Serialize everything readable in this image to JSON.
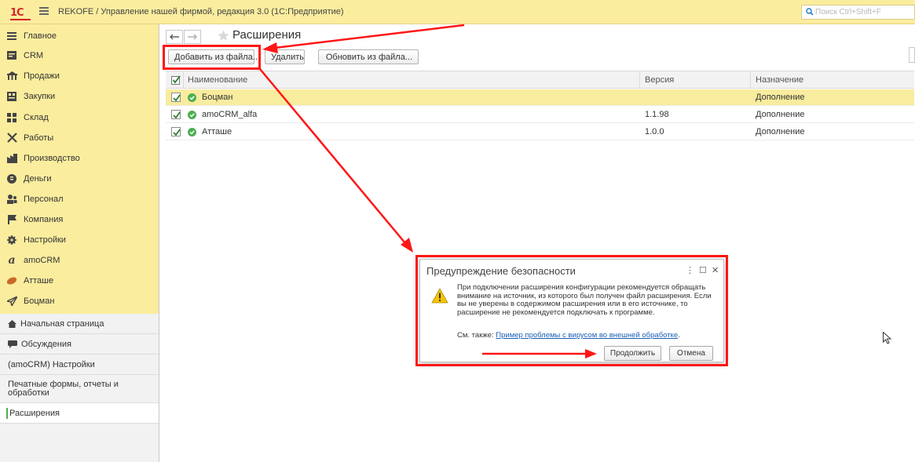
{
  "window": {
    "logo": "1С",
    "title": "REKOFE / Управление нашей фирмой, редакция 3.0  (1С:Предприятие)",
    "search_placeholder": "Поиск Ctrl+Shift+F"
  },
  "sidebar": {
    "sections": [
      {
        "label": "Главное",
        "icon": "menu-icon"
      },
      {
        "label": "CRM",
        "icon": "crm-icon"
      },
      {
        "label": "Продажи",
        "icon": "sales-icon"
      },
      {
        "label": "Закупки",
        "icon": "purchases-icon"
      },
      {
        "label": "Склад",
        "icon": "warehouse-icon"
      },
      {
        "label": "Работы",
        "icon": "works-icon"
      },
      {
        "label": "Производство",
        "icon": "production-icon"
      },
      {
        "label": "Деньги",
        "icon": "money-icon"
      },
      {
        "label": "Персонал",
        "icon": "staff-icon"
      },
      {
        "label": "Компания",
        "icon": "company-flag-icon"
      },
      {
        "label": "Настройки",
        "icon": "gear-icon"
      },
      {
        "label": "amoCRM",
        "icon": "amocrm-icon"
      },
      {
        "label": "Атташе",
        "icon": "attache-icon"
      },
      {
        "label": "Боцман",
        "icon": "paper-plane-icon"
      }
    ],
    "links": [
      {
        "label": "Начальная страница",
        "icon": "home-icon"
      },
      {
        "label": "Обсуждения",
        "icon": "chat-icon"
      },
      {
        "label": "(amoCRM) Настройки"
      },
      {
        "label": "Печатные формы, отчеты и обработки"
      },
      {
        "label": "Расширения",
        "active": true
      }
    ]
  },
  "form": {
    "title": "Расширения",
    "toolbar": {
      "add_from_file": "Добавить из файла...",
      "delete": "Удалить",
      "update_from_file": "Обновить из файла..."
    },
    "columns": [
      "Наименование",
      "Версия",
      "Назначение"
    ],
    "rows": [
      {
        "checked": true,
        "name": "Боцман",
        "version": "",
        "purpose": "Дополнение",
        "selected": true
      },
      {
        "checked": true,
        "name": "amoCRM_alfa",
        "version": "1.1.98",
        "purpose": "Дополнение",
        "selected": false
      },
      {
        "checked": true,
        "name": "Атташе",
        "version": "1.0.0",
        "purpose": "Дополнение",
        "selected": false
      }
    ]
  },
  "dialog": {
    "title": "Предупреждение безопасности",
    "message": "При подключении расширения конфигурации рекомендуется обращать внимание на источник, из которого был получен файл расширения. Если вы не уверены в содержимом расширения или в его источнике, то расширение не рекомендуется подключать к программе.",
    "see_also_label": "См. также: ",
    "see_also_link": "Пример проблемы с вирусом во внешней обработке",
    "see_also_end": ".",
    "continue_button": "Продолжить",
    "cancel_button": "Отмена"
  },
  "colors": {
    "accent_yellow": "#fbed9e",
    "selected_row": "#f8ec9e",
    "annotation_red": "#ff1616",
    "ok_green": "#4caf50",
    "logo_red": "#d6242c"
  }
}
